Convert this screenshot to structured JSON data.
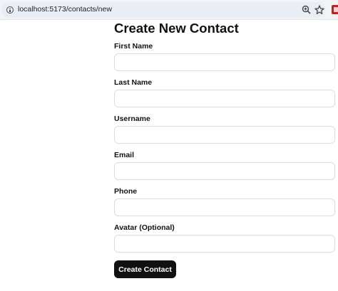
{
  "browser": {
    "url": "localhost:5173/contacts/new",
    "icons": [
      "site-info-icon",
      "zoom-icon",
      "star-icon",
      "extension-icon"
    ]
  },
  "form": {
    "title": "Create New Contact",
    "fields": [
      {
        "label": "First Name",
        "value": ""
      },
      {
        "label": "Last Name",
        "value": ""
      },
      {
        "label": "Username",
        "value": ""
      },
      {
        "label": "Email",
        "value": ""
      },
      {
        "label": "Phone",
        "value": ""
      },
      {
        "label": "Avatar (Optional)",
        "value": ""
      }
    ],
    "submit_label": "Create Contact"
  },
  "colors": {
    "button_bg": "#111111",
    "button_text": "#ffffff",
    "input_border": "#dcdcdc",
    "address_bar_bg": "#e9eef6"
  }
}
